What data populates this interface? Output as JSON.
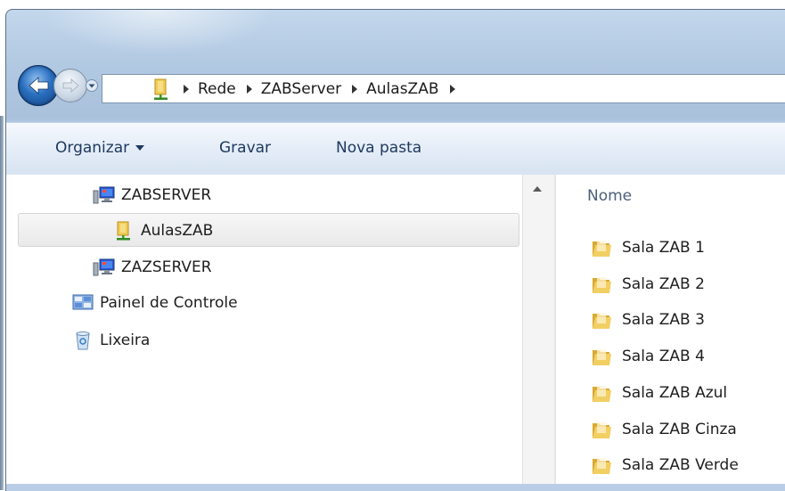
{
  "address_bar": {
    "breadcrumbs": [
      "Rede",
      "ZABServer",
      "AulasZAB"
    ]
  },
  "toolbar": {
    "organize_label": "Organizar",
    "burn_label": "Gravar",
    "new_folder_label": "Nova pasta"
  },
  "nav_pane": {
    "items": [
      {
        "label": "ZABSERVER",
        "icon": "network-computer-icon"
      },
      {
        "label": "AulasZAB",
        "icon": "shared-folder-icon",
        "selected": true
      },
      {
        "label": "ZAZSERVER",
        "icon": "network-computer-icon"
      },
      {
        "label": "Painel de Controle",
        "icon": "control-panel-icon"
      },
      {
        "label": "Lixeira",
        "icon": "recycle-bin-icon"
      }
    ]
  },
  "content": {
    "column_header": "Nome",
    "files": [
      {
        "name": "Sala ZAB 1",
        "icon": "folder-icon"
      },
      {
        "name": "Sala ZAB 2",
        "icon": "folder-icon"
      },
      {
        "name": "Sala ZAB 3",
        "icon": "folder-icon"
      },
      {
        "name": "Sala ZAB 4",
        "icon": "folder-icon"
      },
      {
        "name": "Sala ZAB Azul",
        "icon": "folder-icon"
      },
      {
        "name": "Sala ZAB Cinza",
        "icon": "folder-icon"
      },
      {
        "name": "Sala ZAB Verde",
        "icon": "folder-icon"
      }
    ]
  },
  "colors": {
    "toolbar_text": "#1e3960",
    "folder_yellow": "#e8c24a",
    "selection_bg": "#ececec",
    "column_header_text": "#4c607a"
  }
}
